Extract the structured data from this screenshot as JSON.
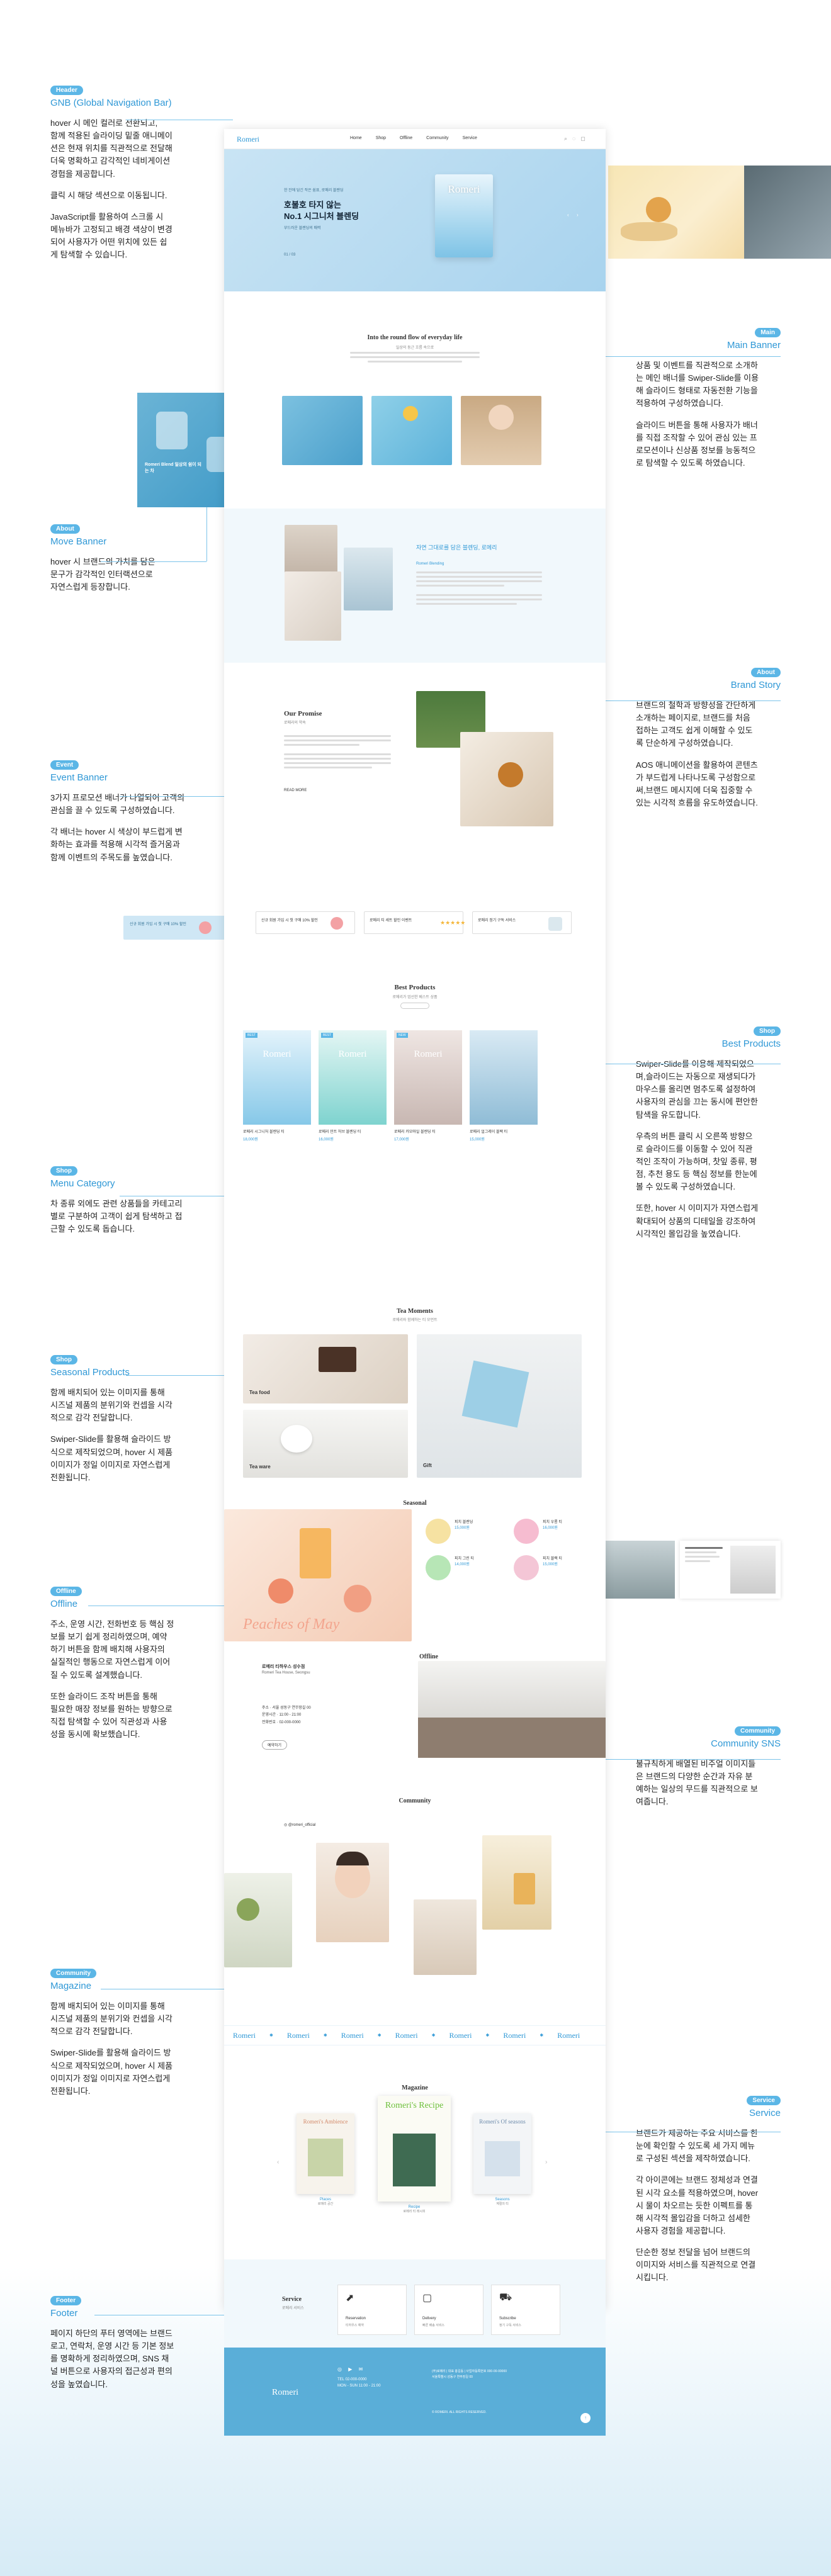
{
  "annotations": {
    "gnb": {
      "tag": "Header",
      "title": "GNB (Global Navigation Bar)",
      "body": [
        "hover 시 메인 컬러로 전환되고,\n함께 적용된 슬라이딩 밑줄 애니메이\n션은 현재 위치를 직관적으로 전달해\n더욱 명확하고 감각적인 네비게이션\n경험을 제공합니다.",
        "클릭 시 해당 섹션으로 이동됩니다.",
        "JavaScript를 활용하여 스크롤 시\n메뉴바가 고정되고 배경 색상이 변경\n되어 사용자가 어떤 위치에 있든 쉽\n게 탐색할 수 있습니다."
      ]
    },
    "main_banner": {
      "tag": "Main",
      "title": "Main Banner",
      "body": [
        "상품 및 이벤트를 직관적으로 소개하\n는 메인 배너를 Swiper-Slide를 이용\n해 슬라이드 형태로 자동전환 기능을\n적용하여 구성하였습니다.",
        "슬라이드 버튼을 통해 사용자가 배너\n를 직접 조작할 수 있어 관심 있는 프\n로모션이나 신상품 정보를 능동적으\n로 탐색할 수 있도록 하였습니다."
      ]
    },
    "move_banner": {
      "tag": "About",
      "title": "Move Banner",
      "body": [
        "hover 시 브랜드의 가치를 담은\n문구가 감각적인 인터랙션으로\n자연스럽게 등장합니다."
      ]
    },
    "brand_story": {
      "tag": "About",
      "title": "Brand Story",
      "body": [
        "브랜드의 철학과 방향성을 간단하게\n소개하는 페이지로, 브랜드를 처음\n접하는 고객도 쉽게 이해할 수 있도\n록 단순하게 구성하였습니다.",
        "AOS 애니메이션을 활용하여 콘텐츠\n가 부드럽게 나타나도록 구성함으로\n써,브랜드 메시지에 더욱 집중할 수\n있는 시각적 흐름을 유도하였습니다."
      ]
    },
    "event_banner": {
      "tag": "Event",
      "title": "Event Banner",
      "body": [
        "3가지 프로모션 배너가 나열되어 고객의\n관심을 끌 수 있도록 구성하였습니다.",
        "각 배너는 hover 시 색상이 부드럽게 변\n화하는 효과를 적용해 시각적 즐거움과\n함께 이벤트의 주목도를 높였습니다."
      ]
    },
    "best_products": {
      "tag": "Shop",
      "title": "Best Products",
      "body": [
        "Swiper-Slide를 이용해 제작되었으\n며,슬라이드는 자동으로 재생되다가\n마우스를 올리면 멈추도록 설정하여\n사용자의 관심을 끄는 동시에 편안한\n탐색을 유도합니다.",
        "우측의 버튼 클릭 시 오른쪽 방향으\n로 슬라이드를 이동할 수 있어 직관\n적인 조작이 가능하며, 찻잎 종류, 평\n점, 추천 용도 등 핵심 정보를 한눈에\n볼 수 있도록 구성하였습니다.",
        "또한, hover 시 이미지가 자연스럽게\n확대되어 상품의 디테일을 강조하여\n시각적인 몰입감을 높였습니다."
      ]
    },
    "menu_category": {
      "tag": "Shop",
      "title": "Menu Category",
      "body": [
        "차 종류 외에도 관련 상품들을 카테고리\n별로 구분하여 고객이 쉽게 탐색하고 접\n근할 수 있도록 돕습니다."
      ]
    },
    "seasonal": {
      "tag": "Shop",
      "title": "Seasonal Products",
      "body": [
        "함께 배치되어 있는 이미지를 통해\n시즈널 제품의 분위기와 컨셉을 시각\n적으로 감각 전달합니다.",
        "Swiper-Slide를 활용해 슬라이드 방\n식으로 제작되었으며, hover 시 제품\n이미지가 정일 이미지로 자연스럽게\n전환됩니다."
      ]
    },
    "offline": {
      "tag": "Offline",
      "title": "Offline",
      "body": [
        "주소, 운영 시간, 전화번호 등 핵심 정\n보를 보기 쉽게 정리하였으며, 예약\n하기 버튼을 함께 배치해 사용자의\n실질적인 행동으로 자연스럽게 이어\n질 수 있도록 설계했습니다.",
        "또한 슬라이드 조작 버튼을 통해\n필요한 매장 정보를 원하는 방향으로\n직접 탐색할 수 있어 직관성과 사용\n성을 동시에 확보했습니다."
      ]
    },
    "community": {
      "tag": "Community",
      "title": "Community SNS",
      "body": [
        "불규칙하게 배열된 비주얼 이미지들\n은 브랜드의 다양한 순간과 자유 분\n예하는 일상의 무드를 직관적으로 보\n여줍니다."
      ]
    },
    "magazine": {
      "tag": "Community",
      "title": "Magazine",
      "body": [
        "함께 배치되어 있는 이미지를 통해\n시즈널 제품의 분위기와 컨셉을 시각\n적으로 감각 전달합니다.",
        "Swiper-Slide를 활용해 슬라이드 방\n식으로 제작되었으며, hover 시 제품\n이미지가 정일 이미지로 자연스럽게\n전환됩니다."
      ]
    },
    "service": {
      "tag": "Service",
      "title": "Service",
      "body": [
        "브랜드가 제공하는 주요 서비스를 한\n눈에 확인할 수 있도록 세 가지 메뉴\n로 구성된 섹션을 제작하였습니다.",
        "각 아이콘에는 브랜드 정체성과 연결\n된 시각 요소를 적용하였으며, hover\n시 물이 차오르는 듯한 이펙트를 통\n해 시각적 몰입감을 더하고 섬세한\n사용자 경험을 제공합니다.",
        "단순한 정보 전달을 넘어 브랜드의\n이미지와 서비스를 직관적으로 연결\n시킵니다."
      ]
    },
    "footer": {
      "tag": "Footer",
      "title": "Footer",
      "body": [
        "페이지 하단의 푸터 영역에는 브랜드\n로고, 연락처, 운영 시간 등 기본 정보\n를 명확하게 정리하였으며, SNS 채\n널 버튼으로 사용자의 접근성과 편의\n성을 높였습니다."
      ]
    }
  },
  "site": {
    "logo": "Romeri",
    "nav": [
      "Home",
      "Shop",
      "Offline",
      "Community",
      "Service"
    ],
    "hero": {
      "eyebrow": "한 잔에 담긴 작은 쉼표, 로메리 블렌딩",
      "headline1": "호불호 타지 않는",
      "headline2": "No.1 시그니처 블렌딩",
      "sub": "부드러운 블렌딩의 매력",
      "counter": "01 / 03",
      "tin_label": "Romeri"
    },
    "about": {
      "title": "Into the round flow of everyday life",
      "sub": "일상의 둥근 흐름 속으로",
      "move_text": "Romeri Blend 일상의 쉼이 되는 차"
    },
    "brand": {
      "heading": "자연 그대로를 담은 블렌딩, 로메리",
      "sub": "Romeri Blending"
    },
    "promise": {
      "title": "Our Promise",
      "sub": "로메리의 약속",
      "more": "READ MORE"
    },
    "events": [
      "신규 회원 가입 시 첫 구매 10% 할인",
      "로메리 티 세트 할인 이벤트",
      "베스트 리뷰 작성 이벤트",
      "로메리 정기 구독 서비스"
    ],
    "best": {
      "title": "Best Products",
      "sub": "로메리가 엄선한 베스트 상품",
      "products": [
        {
          "badge": "BEST",
          "name": "로메리 시그니처 블렌딩 티",
          "price": "18,000원"
        },
        {
          "badge": "BEST",
          "name": "로메리 민트 허브 블렌딩 티",
          "price": "16,000원"
        },
        {
          "badge": "NEW",
          "name": "로메리 카모마일 블렌딩 티",
          "price": "17,000원"
        },
        {
          "badge": "",
          "name": "로메리 얼그레이 블랙 티",
          "price": "15,000원"
        }
      ]
    },
    "moments": {
      "title": "Tea Moments",
      "sub": "로메리와 함께하는 티 모먼트",
      "cats": [
        "Tea food",
        "Tea ware",
        "Gift"
      ]
    },
    "seasonal": {
      "title": "Seasonal",
      "script": "Peaches of May",
      "items": [
        {
          "name": "피치 블렌딩",
          "price": "15,000원"
        },
        {
          "name": "피치 우롱 티",
          "price": "16,000원"
        },
        {
          "name": "피치 그린 티",
          "price": "14,000원"
        },
        {
          "name": "피치 블랙 티",
          "price": "15,000원"
        }
      ]
    },
    "offline": {
      "title": "Offline",
      "shop": "로메리 티하우스 성수점",
      "shop_en": "Romeri Tea House, Seongsu",
      "info": [
        {
          "k": "주소",
          "v": "서울 성동구 연무장길 00"
        },
        {
          "k": "운영시간",
          "v": "11:00 - 21:00"
        },
        {
          "k": "전화번호",
          "v": "02-000-0000"
        }
      ],
      "reserve": "예약하기"
    },
    "community": {
      "title": "Community",
      "handle": "@romeri_official"
    },
    "marquee": [
      "Romeri",
      "Romeri",
      "Romeri",
      "Romeri",
      "Romeri",
      "Romeri",
      "Romeri"
    ],
    "magazine": {
      "title": "Magazine",
      "items": [
        {
          "cover": "Romeri's Ambience",
          "name": "Places",
          "sub": "로메리 공간"
        },
        {
          "cover": "Romeri's Recipe",
          "name": "Recipe",
          "sub": "로메리 티 레시피"
        },
        {
          "cover": "Romeri's Of seasons",
          "name": "Seasons",
          "sub": "계절의 티"
        }
      ]
    },
    "service": {
      "title": "Service",
      "sub": "로메리 서비스",
      "items": [
        {
          "name": "Reservation",
          "sub": "티하우스 예약"
        },
        {
          "name": "Delivery",
          "sub": "빠른 배송 서비스"
        },
        {
          "name": "Subscribe",
          "sub": "정기 구독 서비스"
        }
      ]
    },
    "footer": {
      "logo": "Romeri",
      "tel": "TEL 02-000-0000",
      "hours": "MON - SUN 11:00 - 21:00",
      "company": "(주)로메리 | 대표 홍길동 | 사업자등록번호 000-00-00000",
      "address": "서울특별시 성동구 연무장길 00",
      "copy": "© ROMERI. ALL RIGHTS RESERVED."
    }
  },
  "colors": {
    "accent": "#5bb6e6",
    "hero": "#cfe8f6",
    "footer": "#5aaed8",
    "peach": "#f19f83"
  }
}
